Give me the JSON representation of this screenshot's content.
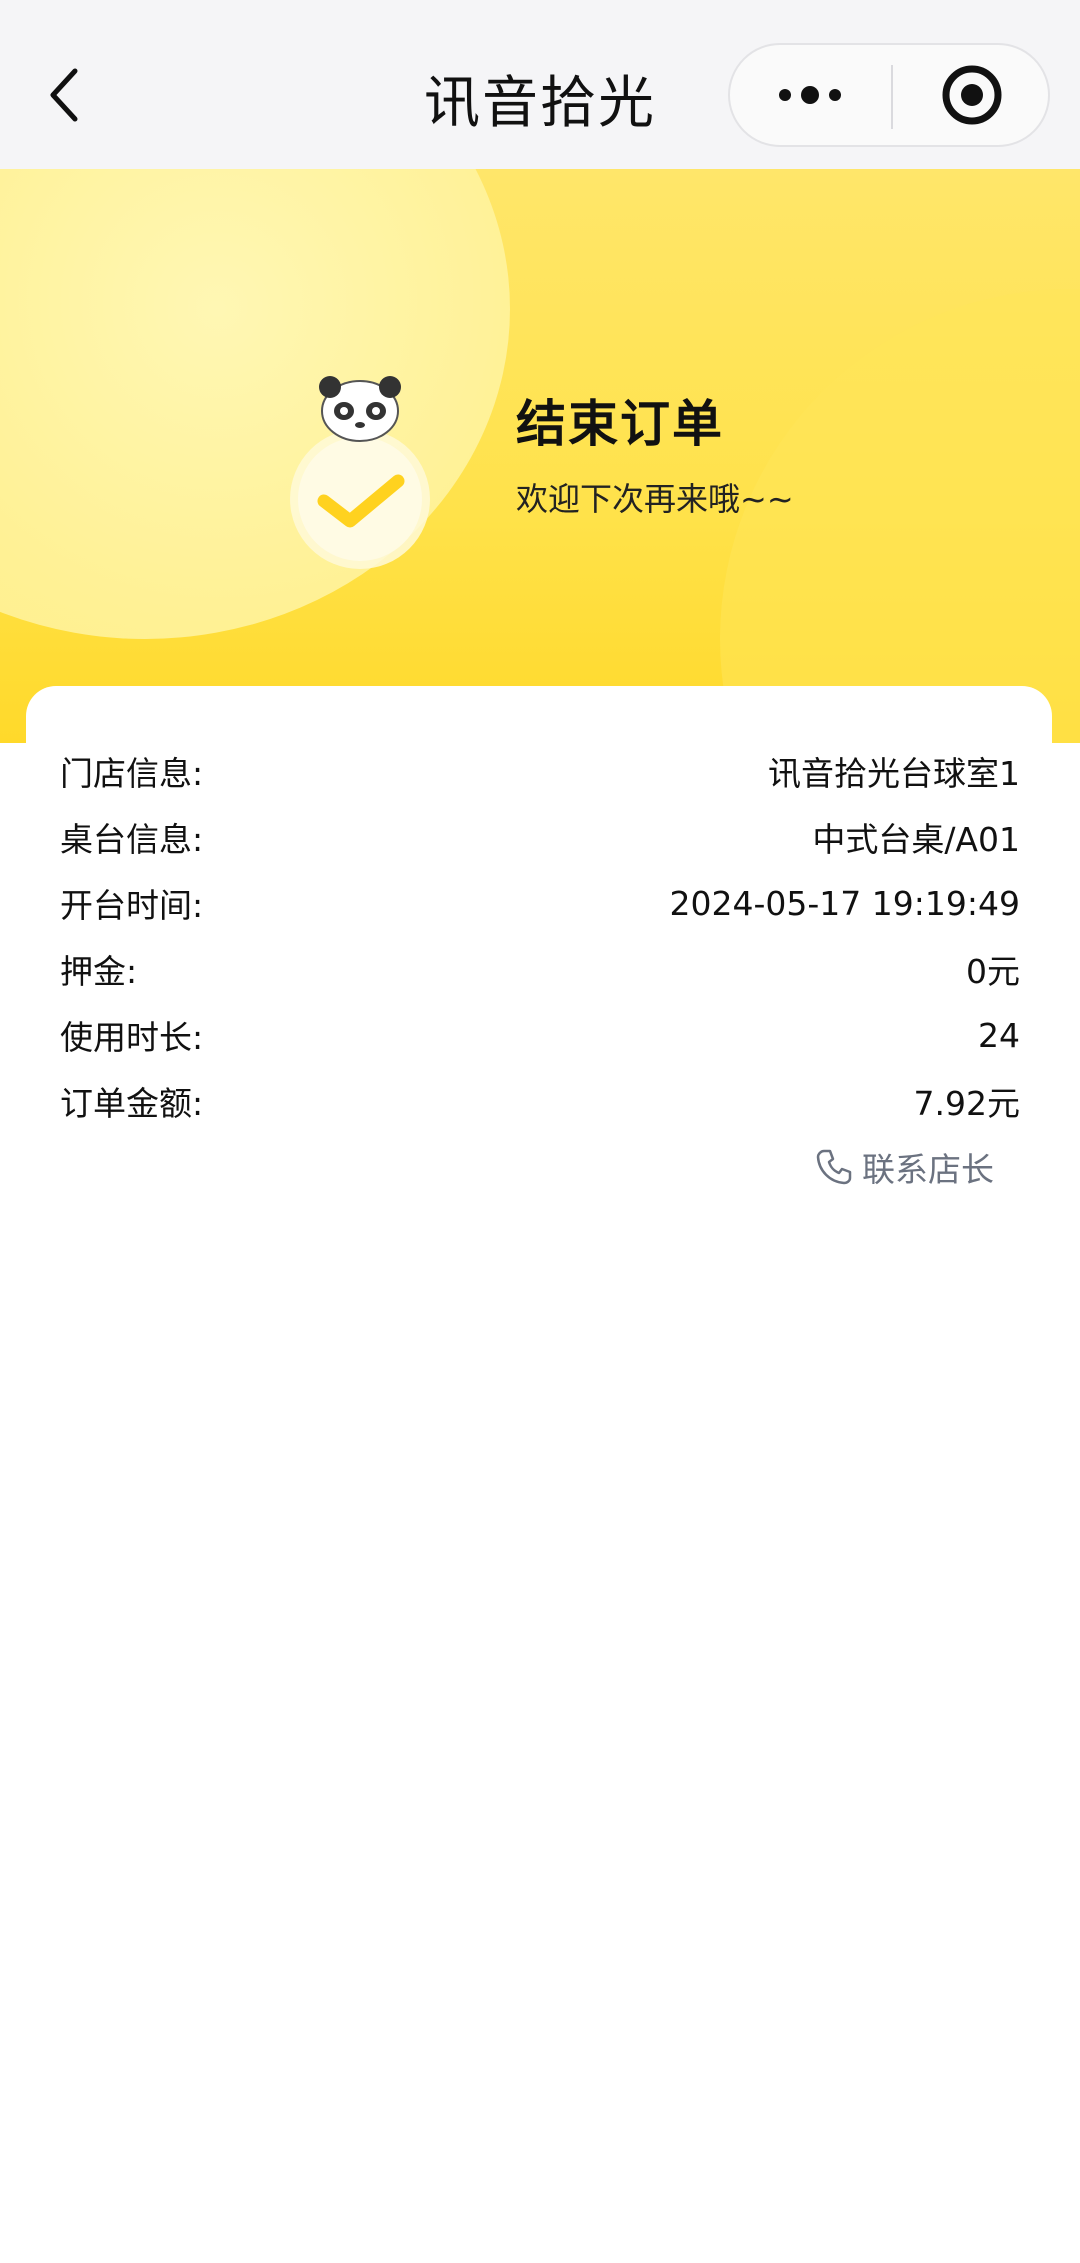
{
  "navbar": {
    "title": "讯音拾光"
  },
  "banner": {
    "title": "结束订单",
    "subtitle": "欢迎下次再来哦~~"
  },
  "order_info": {
    "rows": [
      {
        "label": "门店信息:",
        "value": "讯音拾光台球室1"
      },
      {
        "label": "桌台信息:",
        "value": "中式台桌/A01"
      },
      {
        "label": "开台时间:",
        "value": "2024-05-17 19:19:49"
      },
      {
        "label": "押金:",
        "value": "0元"
      },
      {
        "label": "使用时长:",
        "value": "24"
      },
      {
        "label": "订单金额:",
        "value": "7.92元"
      }
    ],
    "contact_label": "联系店长"
  },
  "colors": {
    "banner_yellow": "#ffe24a",
    "check_yellow": "#ffd21f",
    "contact_gray": "#6b7280"
  },
  "icons": {
    "back": "chevron-left-icon",
    "more": "more-dots-icon",
    "close": "target-circle-icon",
    "mascot": "panda-mascot-icon",
    "check": "check-icon",
    "phone": "phone-icon"
  }
}
